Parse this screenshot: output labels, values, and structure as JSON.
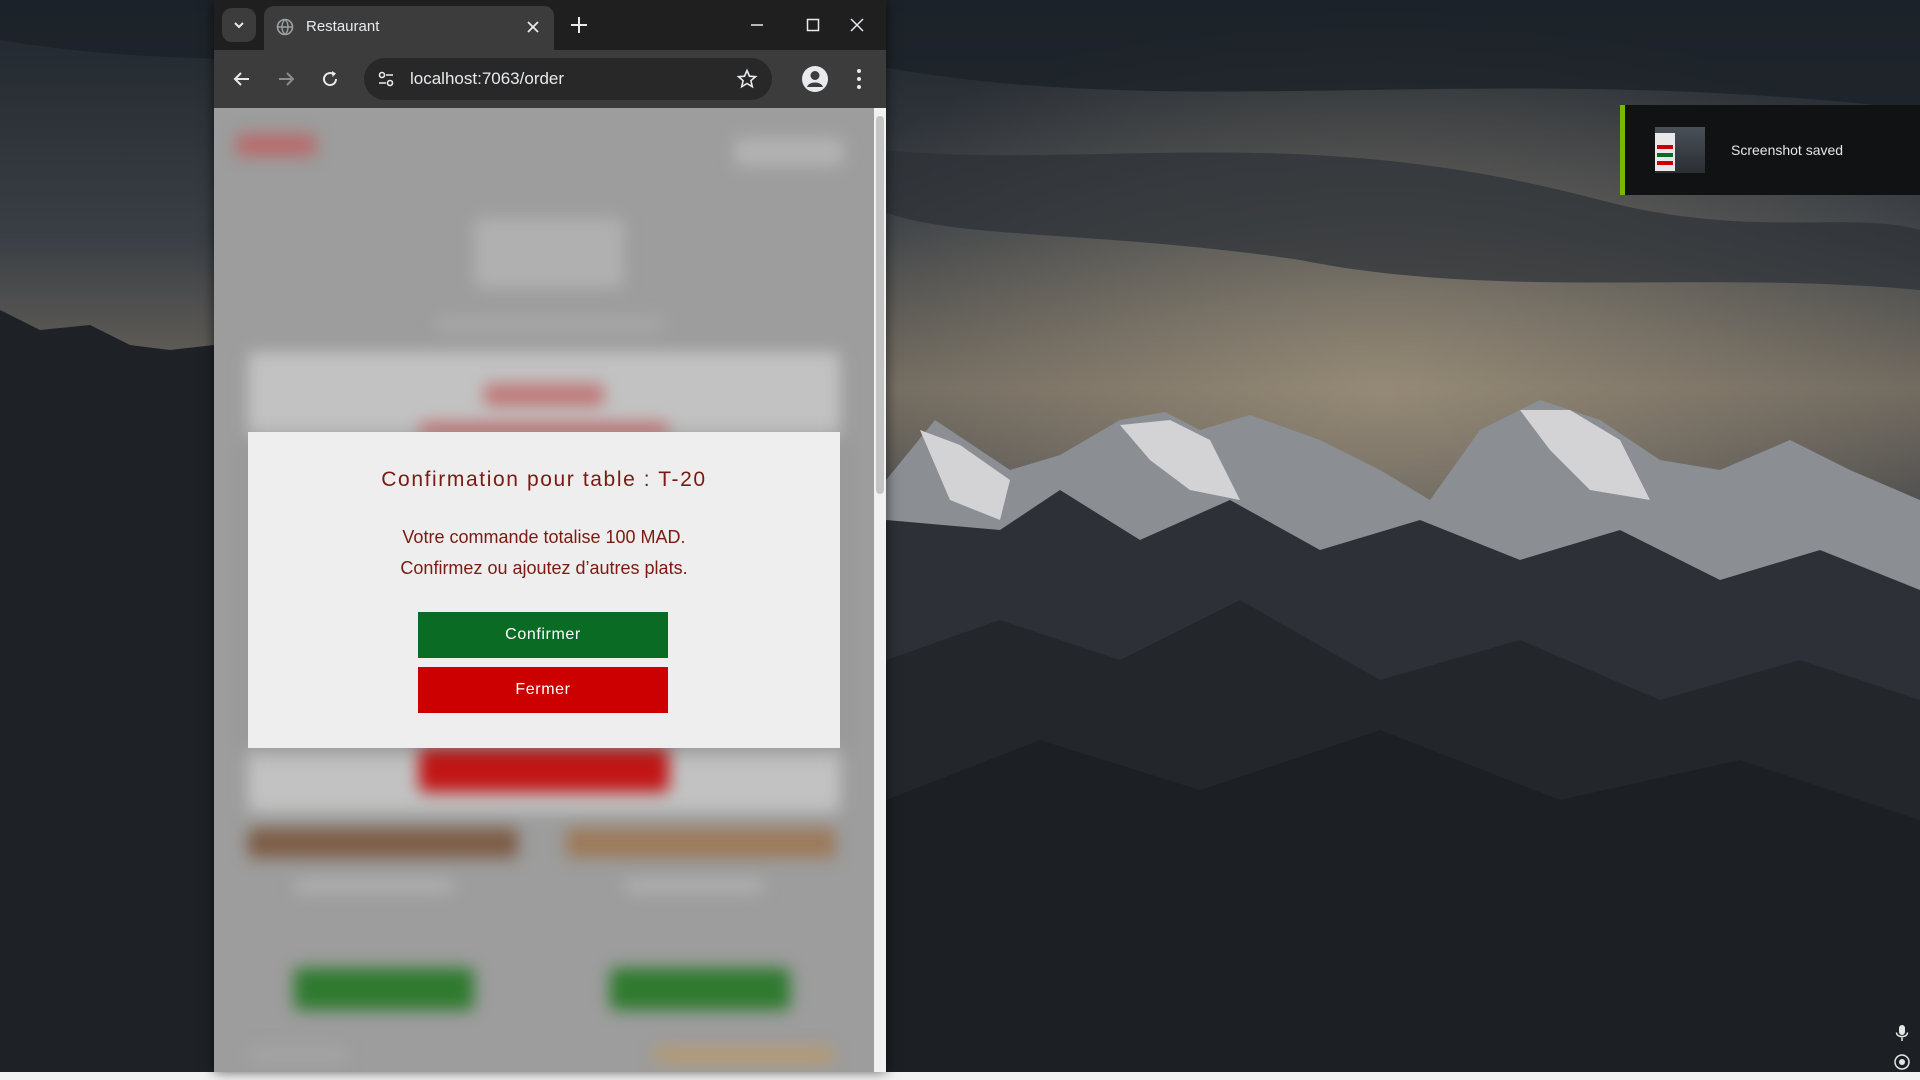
{
  "browser": {
    "tab_title": "Restaurant",
    "url": "localhost:7063/order",
    "icons": [
      "tab-search-icon",
      "globe-icon",
      "close-icon",
      "plus-icon",
      "minimize-icon",
      "maximize-icon",
      "window-close-icon",
      "back-arrow-icon",
      "forward-arrow-icon",
      "reload-icon",
      "site-info-icon",
      "star-icon",
      "profile-icon",
      "kebab-menu-icon"
    ]
  },
  "modal": {
    "title": "Confirmation pour table : T-20",
    "message_line1": "Votre commande totalise 100 MAD.",
    "message_line2": "Confirmez ou ajoutez d’autres plats.",
    "confirm_label": "Confirmer",
    "close_label": "Fermer",
    "colors": {
      "text": "#7a1a12",
      "confirm": "#0a6b24",
      "close": "#cc0000"
    }
  },
  "notification": {
    "text": "Screenshot saved",
    "accent": "#76b900"
  },
  "tray": {
    "icons": [
      "microphone-icon",
      "capture-icon"
    ]
  }
}
